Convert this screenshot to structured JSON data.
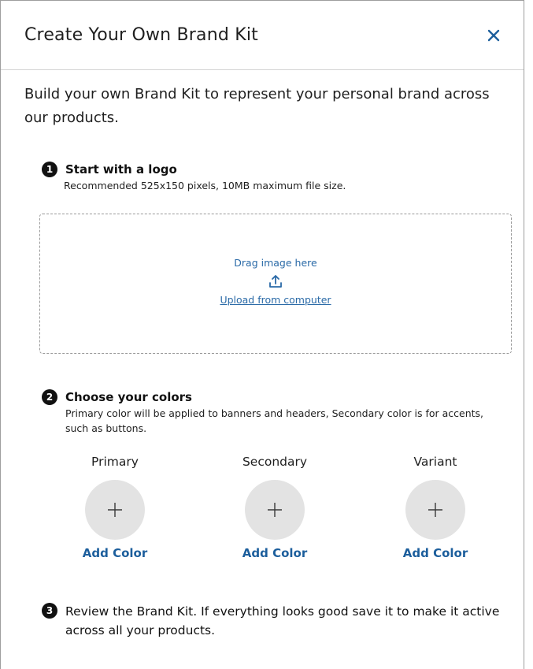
{
  "header": {
    "title": "Create Your Own Brand Kit"
  },
  "intro": "Build your own Brand Kit to represent your personal brand across our products.",
  "steps": {
    "logo": {
      "number": "1",
      "title": "Start with a logo",
      "description": "Recommended 525x150 pixels, 10MB maximum file size."
    },
    "colors": {
      "number": "2",
      "title": "Choose your colors",
      "description": "Primary color will be applied to banners and headers, Secondary color is for accents, such as buttons."
    },
    "review": {
      "number": "3",
      "title": "Review the Brand Kit. If everything looks good save it to make it active across all your products."
    }
  },
  "dropzone": {
    "drag_text": "Drag image here",
    "upload_link": "Upload from computer"
  },
  "colors": [
    {
      "label": "Primary",
      "action": "Add Color"
    },
    {
      "label": "Secondary",
      "action": "Add Color"
    },
    {
      "label": "Variant",
      "action": "Add Color"
    }
  ],
  "theme": {
    "link_color": "#2a6aa7",
    "accent_color": "#1c5e9c",
    "swatch_color": "#e3e3e3"
  },
  "icons": {
    "close": "close-icon",
    "upload": "upload-icon",
    "plus": "plus-icon"
  }
}
